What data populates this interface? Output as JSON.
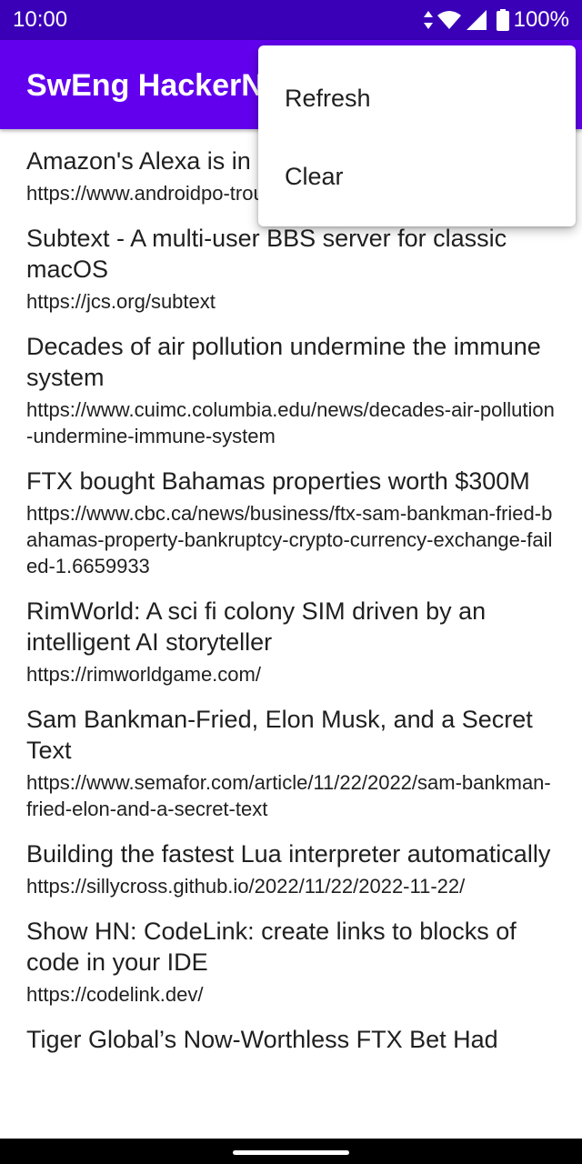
{
  "status_bar": {
    "time": "10:00",
    "battery": "100%",
    "icons": [
      "data-arrows-icon",
      "wifi-icon",
      "signal-icon",
      "battery-icon"
    ]
  },
  "app_bar": {
    "title": "SwEng HackerNews"
  },
  "colors": {
    "status_bar": "#3a00b8",
    "app_bar": "#6200ee"
  },
  "menu": {
    "items": [
      {
        "label": "Refresh"
      },
      {
        "label": "Clear"
      }
    ]
  },
  "stories": [
    {
      "title": "Amazon's Alexa is in",
      "url": "https://www.androidpo​-trouble/"
    },
    {
      "title": "Subtext - A multi-user BBS server for classic macOS",
      "url": "https://jcs.org/subtext"
    },
    {
      "title": "Decades of air pollution undermine the immune system",
      "url": "https://www.cuimc.columbia.edu/news/decades-air-pollution-undermine-immune-system"
    },
    {
      "title": "FTX bought Bahamas properties worth $300M",
      "url": "https://www.cbc.ca/news/business/ftx-sam-bankman-fried-bahamas-property-bankruptcy-crypto-currency-exchange-failed-1.6659933"
    },
    {
      "title": "RimWorld: A sci fi colony SIM driven by an intelligent AI storyteller",
      "url": "https://rimworldgame.com/"
    },
    {
      "title": "Sam Bankman-Fried, Elon Musk, and a Secret Text",
      "url": "https://www.semafor.com/article/11/22/2022/sam-bankman-fried-elon-and-a-secret-text"
    },
    {
      "title": "Building the fastest Lua interpreter automatically",
      "url": "https://sillycross.github.io/2022/11/22/2022-11-22/"
    },
    {
      "title": "Show HN: CodeLink: create links to blocks of code in your IDE",
      "url": "https://codelink.dev/"
    },
    {
      "title": "Tiger Global’s Now-Worthless FTX Bet Had",
      "url": ""
    }
  ]
}
